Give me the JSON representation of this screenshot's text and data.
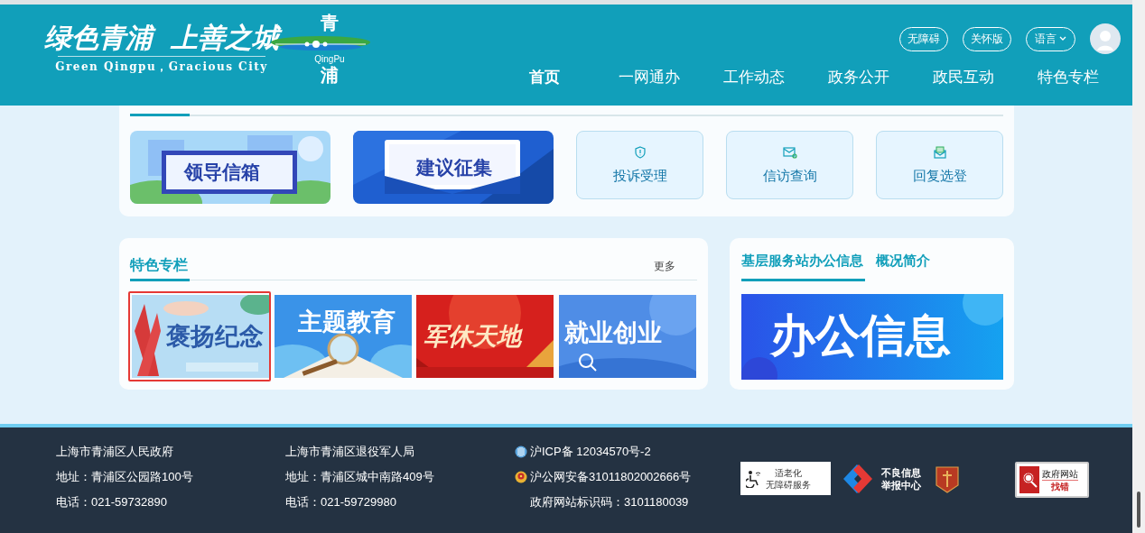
{
  "header": {
    "slogan": "绿色青浦  上善之城",
    "slogan_en": "Green Qingpu，Gracious City",
    "emblem_top": "青",
    "emblem_en": "QingPu",
    "emblem_bottom": "浦",
    "tools": [
      {
        "label": "无障碍",
        "kind": "pill"
      },
      {
        "label": "关怀版",
        "kind": "pill"
      },
      {
        "label": "语言",
        "kind": "dropdown"
      },
      {
        "kind": "avatar"
      }
    ],
    "nav": [
      {
        "label": "首页",
        "selected": true
      },
      {
        "label": "一网通办",
        "selected": false
      },
      {
        "label": "工作动态",
        "selected": false
      },
      {
        "label": "政务公开",
        "selected": false
      },
      {
        "label": "政民互动",
        "selected": false
      },
      {
        "label": "特色专栏",
        "selected": false
      }
    ]
  },
  "interaction": {
    "banners": [
      {
        "label": "领导信箱",
        "kind": "green"
      },
      {
        "label": "建议征集",
        "kind": "blue"
      }
    ],
    "services": [
      {
        "label": "投诉受理",
        "kind": "shield"
      },
      {
        "label": "信访查询",
        "kind": "mail"
      },
      {
        "label": "回复选登",
        "kind": "inbox"
      }
    ]
  },
  "features": {
    "title": "特色专栏",
    "more": "更多",
    "tiles": [
      {
        "label": "褒扬纪念",
        "kind": "ribbon",
        "selected": true
      },
      {
        "label": "主题教育",
        "kind": "book",
        "selected": false
      },
      {
        "label": "军休天地",
        "kind": "red",
        "selected": false
      },
      {
        "label": "就业创业",
        "kind": "search",
        "selected": false
      }
    ]
  },
  "stations": {
    "tabs": [
      {
        "label": "基层服务站办公信息",
        "selected": true
      },
      {
        "label": "概况简介",
        "selected": false
      }
    ],
    "banner": "办公信息"
  },
  "footer": {
    "columns": [
      [
        "上海市青浦区人民政府",
        "地址：青浦区公园路100号",
        "电话：021-59732890"
      ],
      [
        "上海市青浦区退役军人局",
        "地址：青浦区城中南路409号",
        "电话：021-59729980"
      ]
    ],
    "records": [
      {
        "text": "沪ICP备 12034570号-2",
        "kind": "icp"
      },
      {
        "text": "沪公网安备31011802002666号",
        "kind": "police"
      },
      {
        "text": "政府网站标识码：3101180039",
        "kind": "plain"
      }
    ],
    "badges": [
      {
        "kind": "elder",
        "lines": [
          "适老化",
          "无障碍服务"
        ]
      },
      {
        "kind": "report",
        "lines": [
          "不良信息",
          "举报中心"
        ]
      },
      {
        "kind": "emblem"
      },
      {
        "kind": "error",
        "lines": [
          "政府网站",
          "找错"
        ]
      }
    ]
  }
}
